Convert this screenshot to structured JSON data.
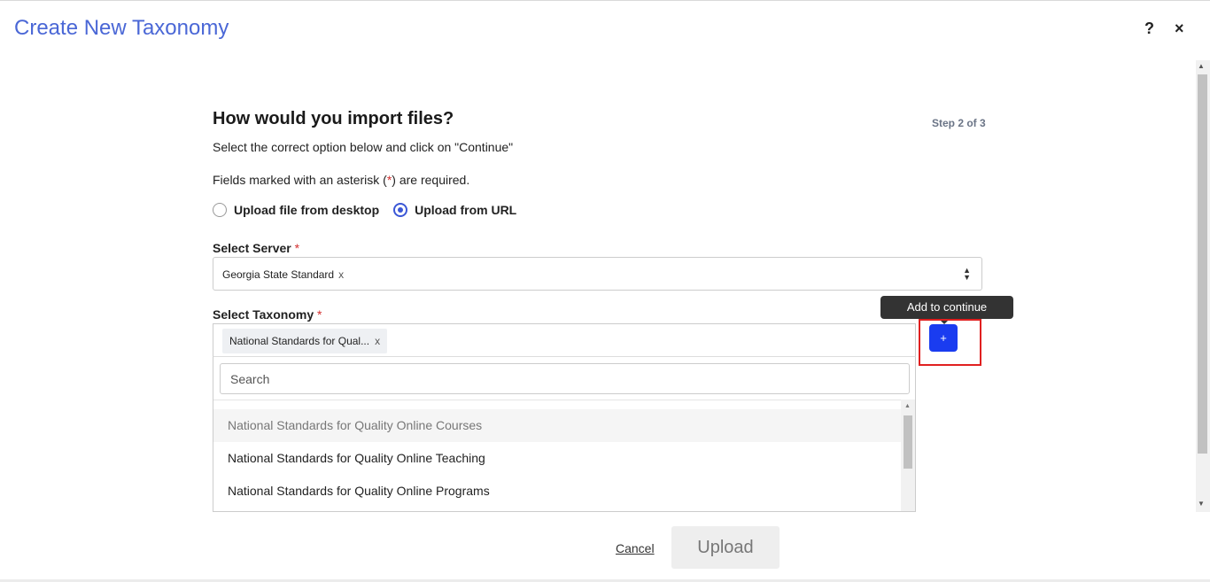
{
  "header": {
    "title": "Create New Taxonomy",
    "help_icon": "?",
    "close_icon": "×"
  },
  "form": {
    "heading": "How would you import files?",
    "step": "Step 2 of 3",
    "instruction": "Select the correct option below and click on \"Continue\"",
    "required_note_prefix": "Fields marked with an asterisk (",
    "required_note_asterisk": "*",
    "required_note_suffix": ") are required.",
    "radio_options": [
      {
        "label": "Upload file from desktop",
        "checked": false
      },
      {
        "label": "Upload from URL",
        "checked": true
      }
    ],
    "server": {
      "label": "Select Server",
      "asterisk": "*",
      "selected": "Georgia State Standard",
      "clear": "x"
    },
    "taxonomy": {
      "label": "Select Taxonomy",
      "asterisk": "*",
      "chip": "National Standards for Qual...",
      "clear": "x",
      "search_placeholder": "Search",
      "options": [
        "National Standards for Quality Online Courses",
        "National Standards for Quality Online Teaching",
        "National Standards for Quality Online Programs"
      ]
    },
    "add_button": "+",
    "tooltip": "Add to continue"
  },
  "footer": {
    "cancel": "Cancel",
    "upload": "Upload"
  }
}
